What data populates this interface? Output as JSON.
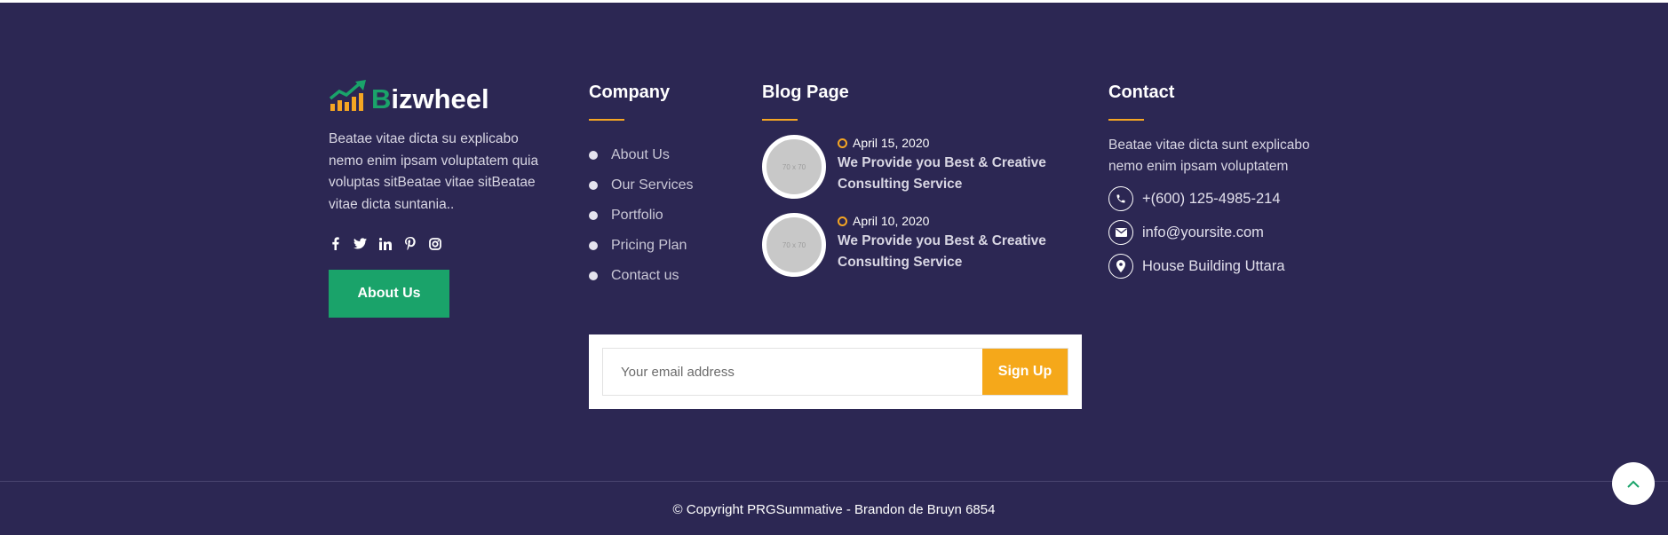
{
  "brand": {
    "logo_b": "B",
    "logo_rest": "izwheel",
    "accent": "#1aa36a",
    "highlight": "#f5a623",
    "background": "#2c2753"
  },
  "about": {
    "text": "Beatae vitae dicta su explicabo nemo enim ipsam voluptatem quia voluptas sitBeatae vitae sitBeatae vitae dicta suntania..",
    "button_label": "About Us",
    "social_icons": [
      "facebook-icon",
      "twitter-icon",
      "linkedin-icon",
      "pinterest-icon",
      "instagram-icon"
    ]
  },
  "company": {
    "title": "Company",
    "links": [
      "About Us",
      "Our Services",
      "Portfolio",
      "Pricing Plan",
      "Contact us"
    ]
  },
  "blog": {
    "title": "Blog Page",
    "posts": [
      {
        "thumb": "70 x 70",
        "date": "April 15, 2020",
        "title": "We Provide you Best & Creative Consulting Service"
      },
      {
        "thumb": "70 x 70",
        "date": "April 10, 2020",
        "title": "We Provide you Best & Creative Consulting Service"
      }
    ]
  },
  "contact": {
    "title": "Contact",
    "text": "Beatae vitae dicta sunt explicabo nemo enim ipsam voluptatem",
    "phone": "+(600) 125-4985-214",
    "email": "info@yoursite.com",
    "address": "House Building Uttara"
  },
  "newsletter": {
    "placeholder": "Your email address",
    "button_label": "Sign Up"
  },
  "copyright": "© Copyright PRGSummative - Brandon de Bruyn 6854"
}
